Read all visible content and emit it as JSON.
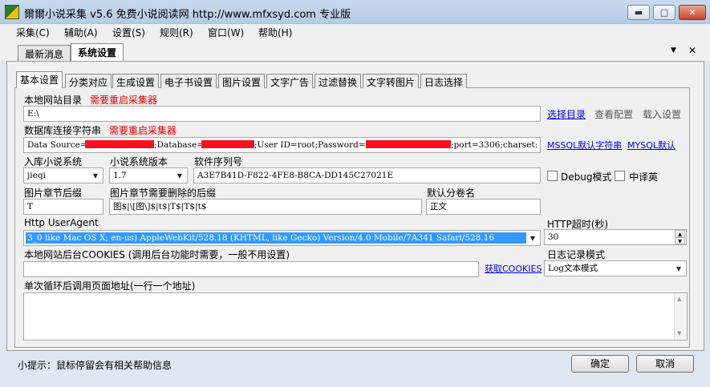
{
  "window": {
    "title": "爾爾小说采集 v5.6 免费小说阅读网 http://www.mfxsyd.com 专业版",
    "min_label": "▬",
    "max_label": "□",
    "close_label": "✕"
  },
  "menu": [
    "采集(C)",
    "辅助(A)",
    "设置(S)",
    "规则(R)",
    "窗口(W)",
    "帮助(H)"
  ],
  "outer_tabs": [
    {
      "label": "最新消息",
      "active": false
    },
    {
      "label": "系统设置",
      "active": true
    }
  ],
  "tab_controls": {
    "dropdown": "▼",
    "close": "✕"
  },
  "inner_tabs": [
    {
      "label": "基本设置",
      "active": true
    },
    {
      "label": "分类对应",
      "active": false
    },
    {
      "label": "生成设置",
      "active": false
    },
    {
      "label": "电子书设置",
      "active": false
    },
    {
      "label": "图片设置",
      "active": false
    },
    {
      "label": "文字广告",
      "active": false
    },
    {
      "label": "过滤替换",
      "active": false
    },
    {
      "label": "文字转图片",
      "active": false
    },
    {
      "label": "日志选择",
      "active": false
    }
  ],
  "local_dir": {
    "label": "本地网站目录",
    "warning": "需要重启采集器",
    "value": "E:\\",
    "choose": "选择目录",
    "view_config": "查看配置",
    "load_config": "载入设置"
  },
  "db": {
    "label": "数据库连接字符串",
    "warning": "需要重启采集器",
    "part1": "Data Source=",
    "part2": ";Database=",
    "part3": ";User ID=root;Password=",
    "part4": ";port=3306;charset:",
    "mssql_default": "MSSQL默认字符串",
    "mysql_default": "MYSQL默认"
  },
  "system": {
    "label": "入库小说系统",
    "value": "jieqi"
  },
  "version": {
    "label": "小说系统版本",
    "value": "1.7"
  },
  "serial": {
    "label": "软件序列号",
    "value": "A3E7B41D-F822-4FE8-B8CA-DD145C27021E"
  },
  "debug": {
    "label": "Debug模式",
    "checked": false
  },
  "zh_en": {
    "label": "中译英",
    "checked": false
  },
  "img_suffix": {
    "label": "图片章节后缀",
    "value": "T"
  },
  "img_remove": {
    "label": "图片章节需要删除的后缀",
    "value": "图$|\\[图\\]$|t$|T$|T$|t$"
  },
  "default_volume": {
    "label": "默认分卷名",
    "value": "正文"
  },
  "ua": {
    "label": "Http UserAgent",
    "value": "3_0 like Mac OS X; en-us) AppleWebKit/528.18 (KHTML, like Gecko) Version/4.0 Mobile/7A341 Safari/528.16"
  },
  "timeout": {
    "label": "HTTP超时(秒)",
    "value": "30",
    "up": "▲",
    "down": "▼"
  },
  "cookies": {
    "label": "本地网站后台COOKIES (调用后台功能时需要，一般不用设置)",
    "value": "",
    "fetch": "获取COOKIES"
  },
  "log_mode": {
    "label": "日志记录模式",
    "value": "Log文本模式"
  },
  "after_loop": {
    "label": "单次循环后调用页面地址(一行一个地址)",
    "value": ""
  },
  "arrows": {
    "down": "▼",
    "up": "▲"
  },
  "hint": "小提示：鼠标停留会有相关帮助信息",
  "ok": "确定",
  "cancel": "取消",
  "colors": {
    "warning": "#e00000",
    "link": "#0000ee",
    "redaction": "#ff1020",
    "selection": "#3399ff"
  }
}
